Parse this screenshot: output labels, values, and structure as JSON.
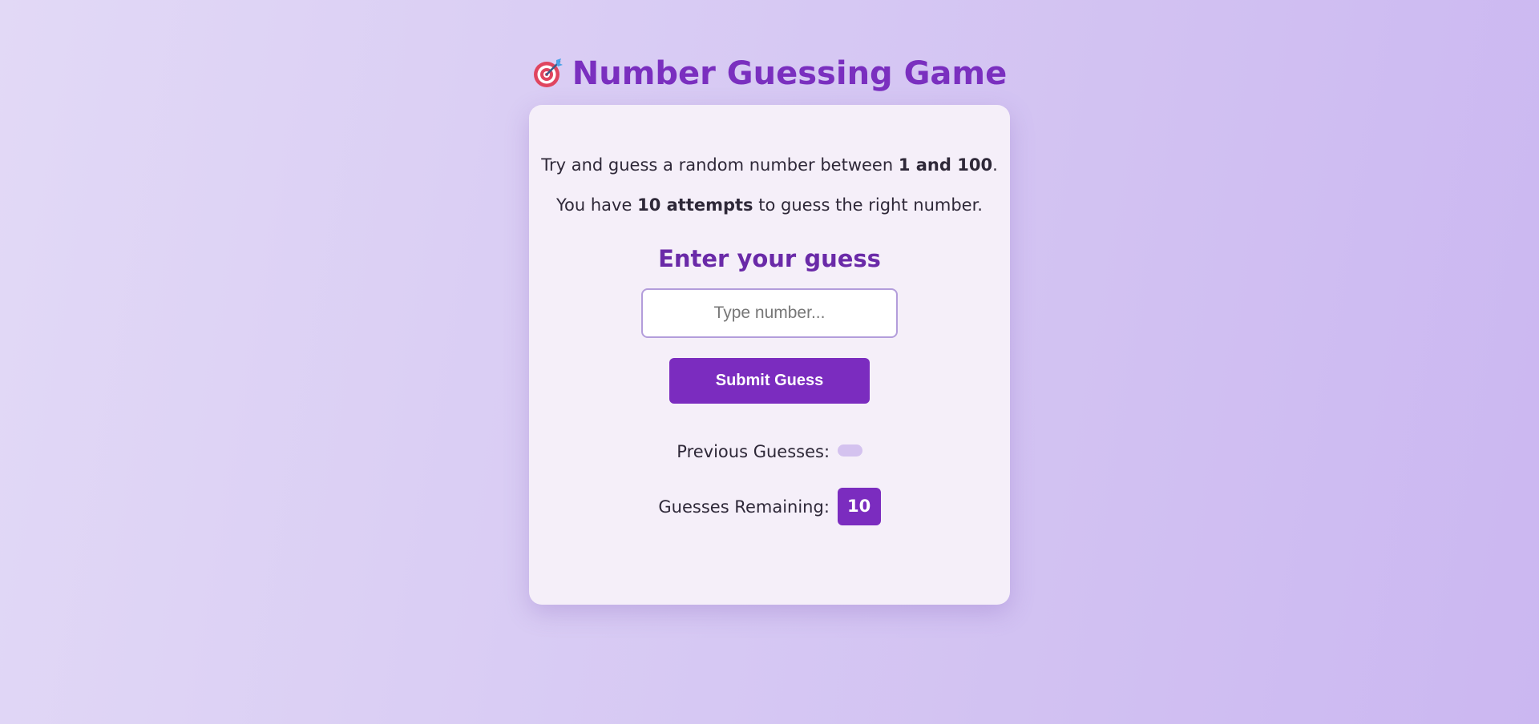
{
  "header": {
    "title": "Number Guessing Game",
    "icon": "target-dart-icon"
  },
  "intro": {
    "line1_prefix": "Try and guess a random number between ",
    "line1_bold": "1 and 100",
    "line1_suffix": ".",
    "line2_prefix": "You have ",
    "line2_bold": "10 attempts",
    "line2_suffix": " to guess the right number."
  },
  "form": {
    "heading": "Enter your guess",
    "input_value": "",
    "input_placeholder": "Type number...",
    "submit_label": "Submit Guess"
  },
  "status": {
    "previous_label": "Previous Guesses:",
    "remaining_label": "Guesses Remaining:",
    "remaining_value": "10"
  },
  "colors": {
    "accent": "#7b2cbf",
    "title": "#7a2fbf",
    "card_bg": "#f5eff9"
  }
}
